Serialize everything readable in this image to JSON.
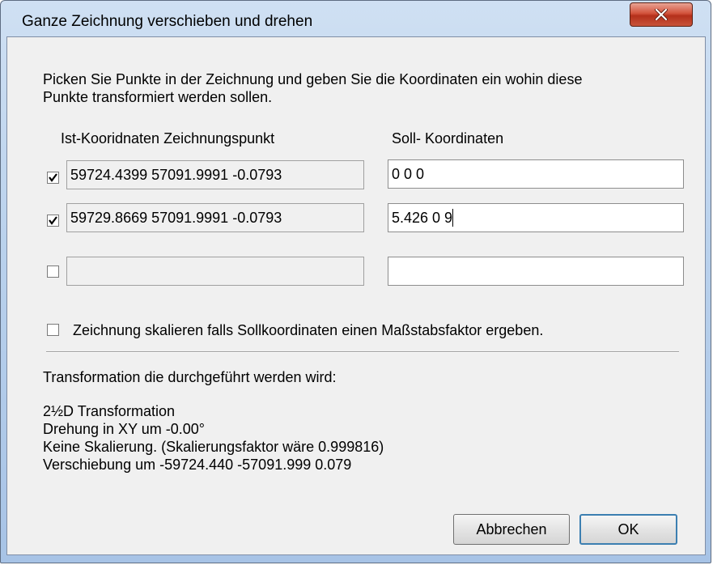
{
  "window": {
    "title": "Ganze Zeichnung verschieben und drehen",
    "close_icon": "close-x-icon"
  },
  "intro": {
    "line1": "Picken Sie Punkte in der Zeichnung und  geben Sie die Koordinaten ein wohin diese",
    "line2": "Punkte transformiert werden sollen."
  },
  "columns": {
    "ist_header": "Ist-Kooridnaten Zeichnungspunkt",
    "soll_header": "Soll- Koordinaten"
  },
  "points": [
    {
      "checked": true,
      "ist": "59724.4399  57091.9991  -0.0793",
      "soll": "0 0 0"
    },
    {
      "checked": true,
      "ist": "59729.8669  57091.9991  -0.0793",
      "soll": "5.426 0 9"
    },
    {
      "checked": false,
      "ist": "",
      "soll": ""
    }
  ],
  "scale_option": {
    "checked": false,
    "label": "Zeichnung skalieren falls Sollkoordinaten  einen Maßstabsfaktor ergeben."
  },
  "result": {
    "heading": "Transformation die durchgeführt werden wird:",
    "lines": [
      "2½D Transformation",
      "Drehung in XY um -0.00°",
      "Keine Skalierung. (Skalierungsfaktor wäre 0.999816)",
      "Verschiebung um -59724.440 -57091.999 0.079"
    ]
  },
  "buttons": {
    "cancel_label": "Abbrechen",
    "ok_label": "OK"
  }
}
